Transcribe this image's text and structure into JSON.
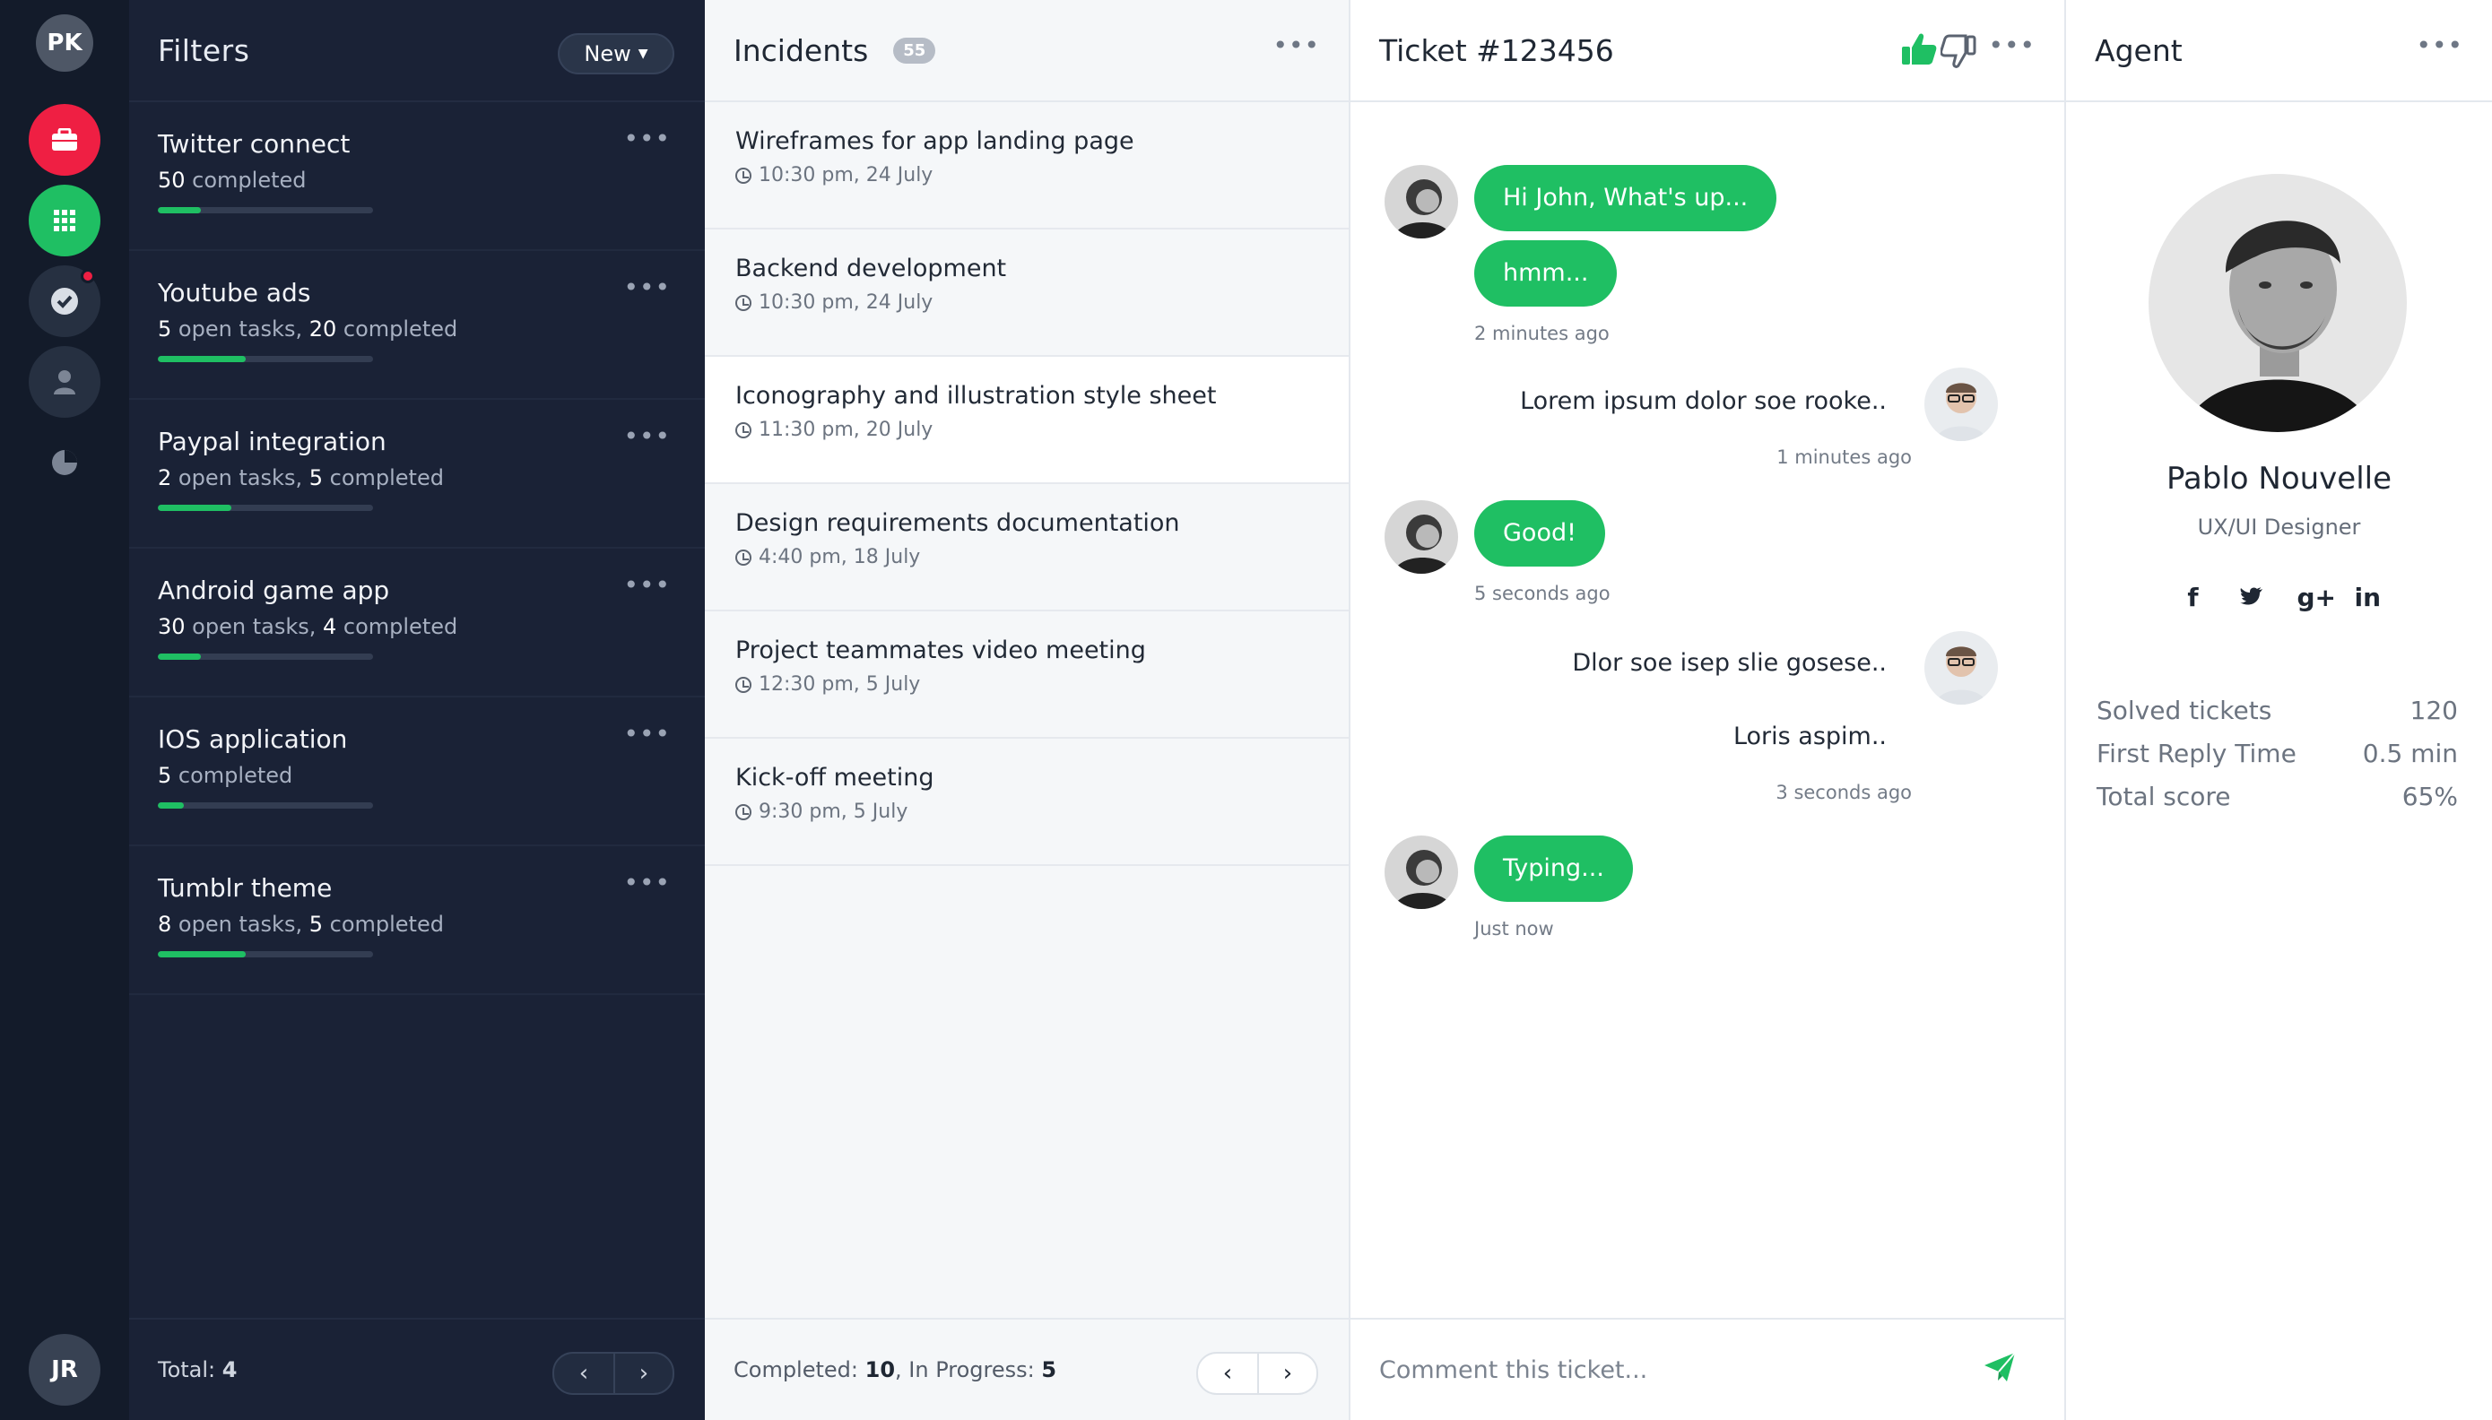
{
  "rail": {
    "top_avatar": "PK",
    "bottom_avatar": "JR",
    "icons": [
      "briefcase-icon",
      "grid-icon",
      "check-icon",
      "user-icon",
      "pie-chart-icon"
    ],
    "colors": {
      "accent_red": "#ef1f43",
      "accent_green": "#1fbf63",
      "rail_bg": "#131b2a"
    }
  },
  "filters": {
    "title": "Filters",
    "new_label": "New",
    "items": [
      {
        "title": "Twitter connect",
        "open": "",
        "open_label": "",
        "completed": "50",
        "completed_label": " completed",
        "progress": 0.2
      },
      {
        "title": "Youtube ads",
        "open": "5",
        "open_label": " open tasks, ",
        "completed": "20",
        "completed_label": " completed",
        "progress": 0.41
      },
      {
        "title": "Paypal integration",
        "open": "2",
        "open_label": " open tasks, ",
        "completed": "5",
        "completed_label": " completed",
        "progress": 0.34
      },
      {
        "title": "Android game app",
        "open": "30",
        "open_label": " open tasks, ",
        "completed": "4",
        "completed_label": " completed",
        "progress": 0.2
      },
      {
        "title": "IOS application",
        "open": "",
        "open_label": "",
        "completed": "5",
        "completed_label": " completed",
        "progress": 0.12
      },
      {
        "title": "Tumblr theme",
        "open": "8",
        "open_label": " open tasks, ",
        "completed": "5",
        "completed_label": " completed",
        "progress": 0.41
      }
    ],
    "footer_label": "Total: ",
    "footer_total": "4",
    "prev": "‹",
    "next": "›"
  },
  "incidents": {
    "title": "Incidents",
    "count": "55",
    "items": [
      {
        "title": "Wireframes for app landing page",
        "time": "10:30 pm, 24 July"
      },
      {
        "title": "Backend development",
        "time": "10:30 pm, 24 July"
      },
      {
        "title": "Iconography and illustration style sheet",
        "time": "11:30 pm, 20 July"
      },
      {
        "title": "Design requirements documentation",
        "time": "4:40 pm, 18 July"
      },
      {
        "title": "Project teammates video meeting",
        "time": "12:30 pm, 5 July"
      },
      {
        "title": "Kick-off meeting",
        "time": "9:30 pm, 5 July"
      }
    ],
    "active_index": 2,
    "footer": {
      "completed_label": "Completed: ",
      "completed": "10",
      "progress_label": ", In Progress: ",
      "in_progress": "5"
    },
    "prev": "‹",
    "next": "›"
  },
  "ticket": {
    "title": "Ticket #123456",
    "messages": {
      "m1a": "Hi John, What's up...",
      "m1b": "hmm...",
      "m1_time": "2 minutes ago",
      "m2": "Lorem ipsum dolor soe rooke..",
      "m2_time": "1 minutes ago",
      "m3": "Good!",
      "m3_time": "5 seconds ago",
      "m4a": "Dlor soe isep slie gosese..",
      "m4b": "Loris aspim..",
      "m4_time": "3 seconds ago",
      "m5": "Typing...",
      "m5_time": "Just now"
    },
    "comment_placeholder": "Comment this ticket..."
  },
  "agent": {
    "title": "Agent",
    "name": "Pablo Nouvelle",
    "role": "UX/UI Designer",
    "socials": [
      "f",
      "t",
      "g+",
      "in"
    ],
    "stats": [
      {
        "label": "Solved tickets",
        "value": "120"
      },
      {
        "label": "First Reply Time",
        "value": "0.5 min"
      },
      {
        "label": "Total score",
        "value": "65%"
      }
    ]
  }
}
